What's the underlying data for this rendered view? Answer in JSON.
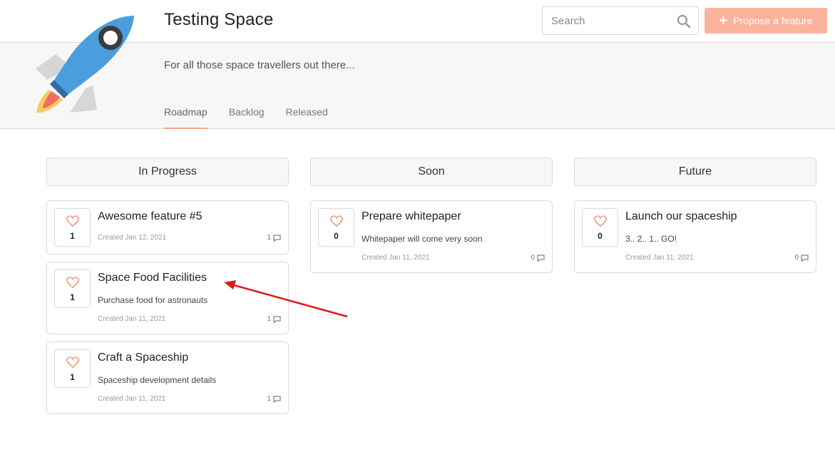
{
  "header": {
    "title": "Testing Space",
    "subtitle": "For all those space travellers out there...",
    "search_placeholder": "Search",
    "propose_label": "Propose a feature",
    "accent_color": "#fbb39c"
  },
  "tabs": [
    {
      "label": "Roadmap",
      "active": true
    },
    {
      "label": "Backlog",
      "active": false
    },
    {
      "label": "Released",
      "active": false
    }
  ],
  "columns": [
    {
      "title": "In Progress",
      "cards": [
        {
          "title": "Awesome feature #5",
          "description": "",
          "votes": "1",
          "created": "Created Jan 12, 2021",
          "comments": "1"
        },
        {
          "title": "Space Food Facilities",
          "description": "Purchase food for astronauts",
          "votes": "1",
          "created": "Created Jan 11, 2021",
          "comments": "1"
        },
        {
          "title": "Craft a Spaceship",
          "description": "Spaceship development details",
          "votes": "1",
          "created": "Created Jan 11, 2021",
          "comments": "1"
        }
      ]
    },
    {
      "title": "Soon",
      "cards": [
        {
          "title": "Prepare whitepaper",
          "description": "Whitepaper will come very soon",
          "votes": "0",
          "created": "Created Jan 11, 2021",
          "comments": "0"
        }
      ]
    },
    {
      "title": "Future",
      "cards": [
        {
          "title": "Launch our spaceship",
          "description": "3.. 2.. 1.. GO!",
          "votes": "0",
          "created": "Created Jan 11, 2021",
          "comments": "0"
        }
      ]
    }
  ]
}
